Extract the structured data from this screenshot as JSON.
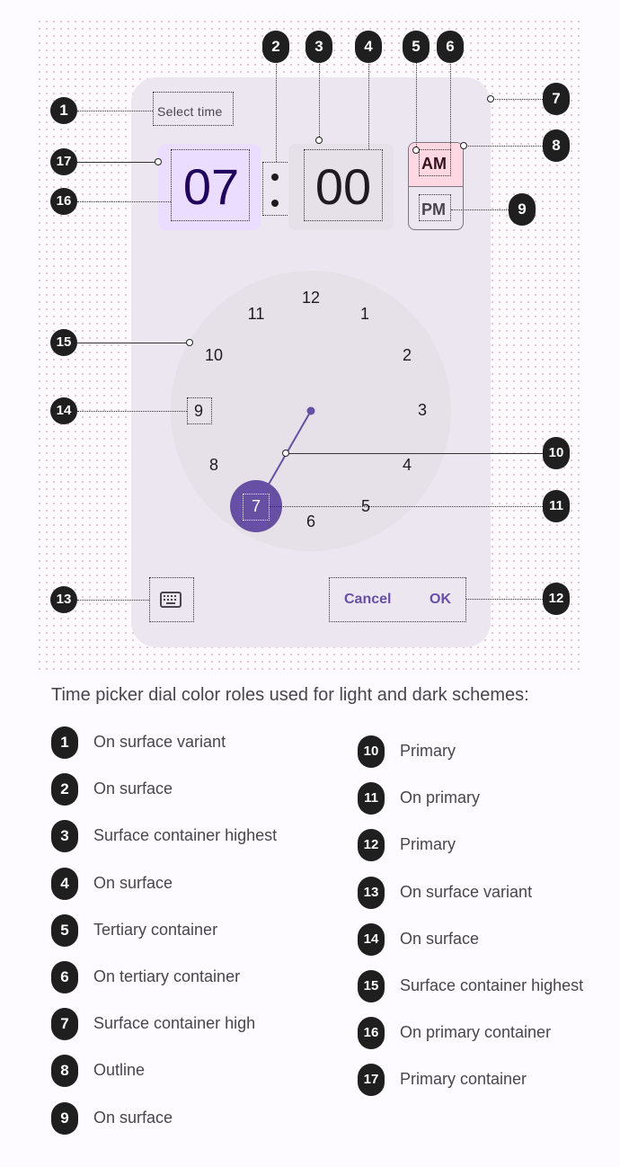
{
  "dialog": {
    "headline": "Select time",
    "hour": "07",
    "minute": "00",
    "am": "AM",
    "pm": "PM",
    "selected_hour": "7",
    "clock_numbers": [
      "12",
      "1",
      "2",
      "3",
      "4",
      "5",
      "6",
      "8",
      "9",
      "10",
      "11"
    ],
    "cancel_label": "Cancel",
    "ok_label": "OK",
    "keyboard_icon": "keyboard-icon"
  },
  "callouts": [
    "1",
    "2",
    "3",
    "4",
    "5",
    "6",
    "7",
    "8",
    "9",
    "10",
    "11",
    "12",
    "13",
    "14",
    "15",
    "16",
    "17"
  ],
  "legend": {
    "title": "Time picker dial color roles used for light and dark schemes:",
    "items": [
      {
        "num": "1",
        "label": "On surface variant"
      },
      {
        "num": "2",
        "label": "On surface"
      },
      {
        "num": "3",
        "label": "Surface container highest"
      },
      {
        "num": "4",
        "label": "On surface"
      },
      {
        "num": "5",
        "label": "Tertiary container"
      },
      {
        "num": "6",
        "label": "On tertiary container"
      },
      {
        "num": "7",
        "label": "Surface container high"
      },
      {
        "num": "8",
        "label": "Outline"
      },
      {
        "num": "9",
        "label": "On surface"
      },
      {
        "num": "10",
        "label": "Primary"
      },
      {
        "num": "11",
        "label": "On primary"
      },
      {
        "num": "12",
        "label": "Primary"
      },
      {
        "num": "13",
        "label": "On surface variant"
      },
      {
        "num": "14",
        "label": "On surface"
      },
      {
        "num": "15",
        "label": "Surface container highest"
      },
      {
        "num": "16",
        "label": "On primary container"
      },
      {
        "num": "17",
        "label": "Primary container"
      }
    ]
  },
  "colors": {
    "surface_container_high": "#ece6f0",
    "surface_container_highest": "#e6e0e9",
    "primary": "#6750a4",
    "primary_container": "#eaddff",
    "on_primary_container": "#21005d",
    "tertiary_container": "#ffd8e4",
    "outline": "#79747e"
  }
}
